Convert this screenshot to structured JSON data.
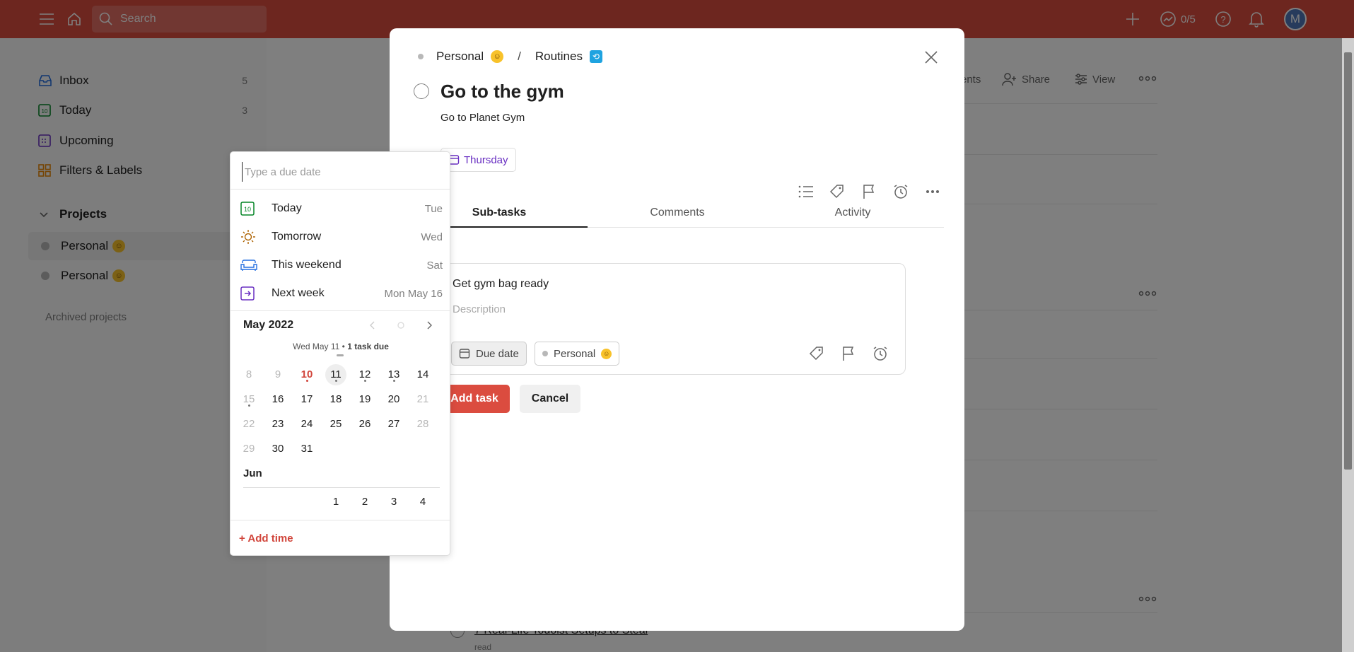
{
  "topbar": {
    "search_placeholder": "Search",
    "karma": "0/5",
    "avatar_initial": "M"
  },
  "sidebar": {
    "items": [
      {
        "label": "Inbox",
        "count": "5"
      },
      {
        "label": "Today",
        "count": "3"
      },
      {
        "label": "Upcoming",
        "count": ""
      },
      {
        "label": "Filters & Labels",
        "count": ""
      }
    ],
    "projects_heading": "Projects",
    "projects": [
      {
        "label": "Personal"
      },
      {
        "label": "Personal"
      }
    ],
    "archived": "Archived projects"
  },
  "main_bg": {
    "toolbar": {
      "comments_partial": "ents",
      "share": "Share",
      "view": "View"
    },
    "bottom_task": "7 Real-Life Todoist Setups to Steal",
    "bottom_label": "read"
  },
  "modal": {
    "breadcrumb": {
      "project": "Personal",
      "separator": "/",
      "section": "Routines"
    },
    "task_title": "Go to the gym",
    "task_description": "Go to Planet Gym",
    "due_chip": "Thursday",
    "tabs": [
      "Sub-tasks",
      "Comments",
      "Activity"
    ],
    "subtask": {
      "name": "Get gym bag ready",
      "description_placeholder": "Description",
      "due_label": "Due date",
      "project_label": "Personal"
    },
    "add_task": "Add task",
    "cancel": "Cancel"
  },
  "picker": {
    "placeholder": "Type a due date",
    "quick": [
      {
        "label": "Today",
        "day": "Tue"
      },
      {
        "label": "Tomorrow",
        "day": "Wed"
      },
      {
        "label": "This weekend",
        "day": "Sat"
      },
      {
        "label": "Next week",
        "day": "Mon May 16"
      }
    ],
    "month": "May 2022",
    "selected_info": "Wed May 11 •",
    "selected_due": "1 task due",
    "weeks": [
      [
        "8",
        "9",
        "10",
        "11",
        "12",
        "13",
        "14"
      ],
      [
        "15",
        "16",
        "17",
        "18",
        "19",
        "20",
        "21"
      ],
      [
        "22",
        "23",
        "24",
        "25",
        "26",
        "27",
        "28"
      ],
      [
        "29",
        "30",
        "31",
        "",
        "",
        "",
        ""
      ]
    ],
    "next_month": "Jun",
    "next_days": [
      "",
      "",
      "",
      "1",
      "2",
      "3",
      "4"
    ],
    "add_time": "+ Add time"
  },
  "colors": {
    "brand_red": "#db4c3f",
    "upcoming_purple": "#692fc2",
    "today_green": "#058527"
  }
}
